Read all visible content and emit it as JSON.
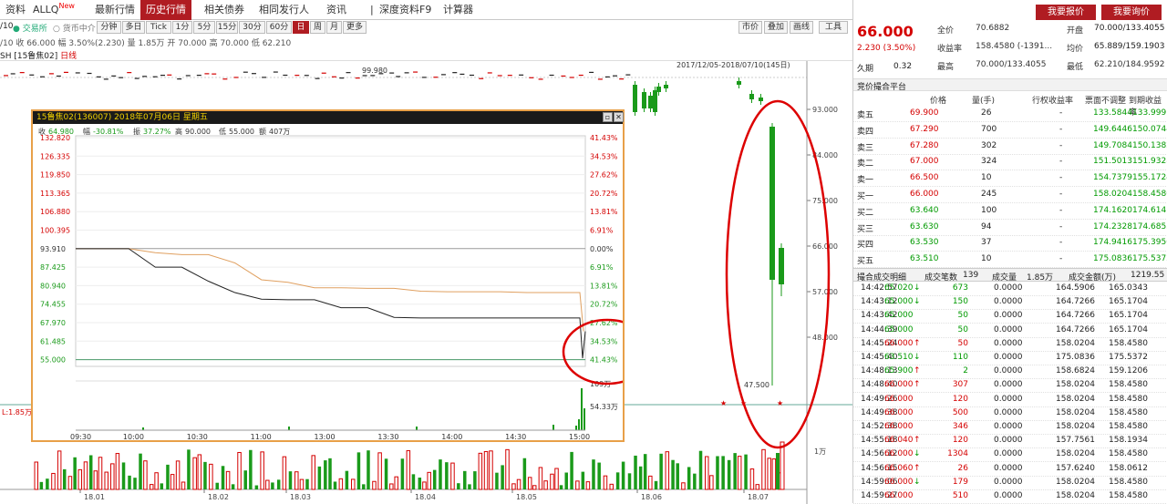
{
  "nav": {
    "tabs": [
      {
        "label": "资料",
        "active": false
      },
      {
        "label": "ALLQ",
        "sup": "New",
        "active": false
      },
      {
        "label": "最新行情",
        "active": false
      },
      {
        "label": "历史行情",
        "active": true
      },
      {
        "label": "相关债券",
        "active": false
      },
      {
        "label": "相同发行人",
        "active": false
      },
      {
        "label": "资讯",
        "active": false
      },
      {
        "label": "|",
        "active": false
      },
      {
        "label": "深度资料F9",
        "active": false
      },
      {
        "label": "计算器",
        "active": false
      }
    ]
  },
  "toolbar": {
    "date_prefix": "/10",
    "market_options": [
      "交易所",
      "货币中介"
    ],
    "periods": [
      {
        "label": "分钟",
        "active": false
      },
      {
        "label": "多日",
        "active": false
      },
      {
        "label": "Tick",
        "active": false
      },
      {
        "label": "1分",
        "active": false
      },
      {
        "label": "5分",
        "active": false
      },
      {
        "label": "15分",
        "active": false
      },
      {
        "label": "30分",
        "active": false
      },
      {
        "label": "60分",
        "active": false
      },
      {
        "label": "日",
        "active": true
      },
      {
        "label": "周",
        "active": false
      },
      {
        "label": "月",
        "active": false
      },
      {
        "label": "更多",
        "active": false
      }
    ],
    "right_buttons": [
      "市价",
      "叠加",
      "画线",
      "工具"
    ]
  },
  "quote_line": "/10 收 66.000 幅 3.50%(2.230) 量 1.85万 开 70.000 高 70.000 低 62.210",
  "security_line": {
    "code": "SH [15鲁焦02]",
    "tag": "日线"
  },
  "chart_header": {
    "range": "2017/12/05-2018/07/10(145日)",
    "annot_high": "99.980",
    "annot_low": "47.500",
    "vol_left": "L:1.85万",
    "vol_axis": "1万"
  },
  "main_chart": {
    "x_labels": [
      "18.01",
      "18.02",
      "18.03",
      "18.04",
      "18.05",
      "18.06",
      "18.07"
    ],
    "y_labels": [
      "93.000",
      "84.000",
      "75.000",
      "66.000",
      "57.000",
      "48.000"
    ]
  },
  "chart_data": [
    {
      "type": "line",
      "title": "15鲁焦02(136007) 2018年07月06日 星期五",
      "summary": {
        "收": "64.980",
        "幅": "-30.81%",
        "振": "37.27%",
        "高": "90.000",
        "低": "55.000",
        "额": "407万"
      },
      "y_left": [
        "132.820",
        "126.335",
        "119.850",
        "113.365",
        "106.880",
        "100.395",
        "93.910",
        "87.425",
        "80.940",
        "74.455",
        "67.970",
        "61.485",
        "55.000"
      ],
      "y_right": [
        "41.43%",
        "34.53%",
        "27.62%",
        "20.72%",
        "13.81%",
        "6.91%",
        "0.00%",
        "6.91%",
        "13.81%",
        "20.72%",
        "27.62%",
        "34.53%",
        "41.43%"
      ],
      "vol_labels": [
        "109万",
        "54.33万"
      ],
      "x": [
        "09:30",
        "10:00",
        "10:30",
        "11:00",
        "13:00",
        "13:30",
        "14:00",
        "14:30",
        "15:00"
      ],
      "series": [
        {
          "values": [
            93.9,
            93.9,
            93.9,
            92.5,
            91.8,
            91.8,
            88.9,
            83.0,
            82.1,
            80.2,
            80.2,
            80.0,
            80.0,
            79.0,
            78.8,
            78.8,
            78.8,
            78.5,
            78.5,
            78.5,
            64.9
          ]
        },
        {
          "values": [
            93.9,
            93.9,
            93.9,
            87.4,
            87.4,
            82.5,
            78.5,
            76.2,
            76.0,
            76.0,
            73.2,
            73.2,
            69.8,
            69.6,
            69.6,
            69.6,
            69.6,
            69.6,
            69.6,
            69.6,
            55.5,
            64.9
          ]
        }
      ]
    }
  ],
  "right": {
    "price": "66.000",
    "change": "2.230 (3.50%)",
    "buttons": [
      "我要报价",
      "我要询价"
    ],
    "stats": [
      [
        "全价",
        "70.6882",
        "开盘",
        "70.000/133.4055"
      ],
      [
        "收益率",
        "158.4580 (-1391...",
        "均价",
        "65.889/159.1903"
      ],
      [
        "最高",
        "70.000/133.4055",
        "最低",
        "62.210/184.9592"
      ]
    ],
    "period_label": "久期",
    "period_val": "0.32",
    "bid_title": "竞价撮合平台",
    "bid_headers": [
      "价格",
      "量(手)",
      "行权收益率",
      "票面不调整",
      "到期收益率"
    ],
    "asks": [
      [
        "卖五",
        "69.900",
        "26",
        "-",
        "133.5844",
        "133.9991"
      ],
      [
        "卖四",
        "67.290",
        "700",
        "-",
        "149.6446",
        "150.0744"
      ],
      [
        "卖三",
        "67.280",
        "302",
        "-",
        "149.7084",
        "150.1382"
      ],
      [
        "卖二",
        "67.000",
        "324",
        "-",
        "151.5013",
        "151.9328"
      ],
      [
        "卖一",
        "66.500",
        "10",
        "-",
        "154.7379",
        "155.1724"
      ]
    ],
    "bids": [
      [
        "买一",
        "66.000",
        "245",
        "-",
        "158.0204",
        "158.4580"
      ],
      [
        "买二",
        "63.640",
        "100",
        "-",
        "174.1620",
        "174.6147"
      ],
      [
        "买三",
        "63.630",
        "94",
        "-",
        "174.2328",
        "174.6855"
      ],
      [
        "买四",
        "63.530",
        "37",
        "-",
        "174.9416",
        "175.3950"
      ],
      [
        "买五",
        "63.510",
        "10",
        "-",
        "175.0836",
        "175.5372"
      ]
    ],
    "trade_header": {
      "title": "撮合成交明细",
      "count_label": "成交笔数",
      "count": "139",
      "vol_label": "成交量",
      "vol": "1.85万",
      "amt_label": "成交金额(万)",
      "amt": "1219.55"
    },
    "trades": [
      [
        "14:42:57",
        "65.020",
        "down",
        "673",
        "0.0000",
        "164.5906",
        "165.0343"
      ],
      [
        "14:43:12",
        "65.000",
        "down",
        "150",
        "0.0000",
        "164.7266",
        "165.1704"
      ],
      [
        "14:43:42",
        "65.000",
        "",
        "50",
        "0.0000",
        "164.7266",
        "165.1704"
      ],
      [
        "14:44:39",
        "65.000",
        "",
        "50",
        "0.0000",
        "164.7266",
        "165.1704"
      ],
      [
        "14:45:24",
        "66.000",
        "up",
        "50",
        "0.0000",
        "158.0204",
        "158.4580"
      ],
      [
        "14:45:40",
        "63.510",
        "down",
        "110",
        "0.0000",
        "175.0836",
        "175.5372"
      ],
      [
        "14:48:13",
        "65.900",
        "up",
        "2",
        "0.0000",
        "158.6824",
        "159.1206"
      ],
      [
        "14:48:40",
        "66.000",
        "up",
        "307",
        "0.0000",
        "158.0204",
        "158.4580"
      ],
      [
        "14:49:26",
        "66.000",
        "",
        "120",
        "0.0000",
        "158.0204",
        "158.4580"
      ],
      [
        "14:49:38",
        "66.000",
        "",
        "500",
        "0.0000",
        "158.0204",
        "158.4580"
      ],
      [
        "14:52:38",
        "66.000",
        "",
        "346",
        "0.0000",
        "158.0204",
        "158.4580"
      ],
      [
        "14:55:18",
        "66.040",
        "up",
        "120",
        "0.0000",
        "157.7561",
        "158.1934"
      ],
      [
        "14:56:12",
        "66.000",
        "down",
        "1304",
        "0.0000",
        "158.0204",
        "158.4580"
      ],
      [
        "14:56:15",
        "66.060",
        "up",
        "26",
        "0.0000",
        "157.6240",
        "158.0612"
      ],
      [
        "14:59:06",
        "66.000",
        "down",
        "179",
        "0.0000",
        "158.0204",
        "158.4580"
      ],
      [
        "14:59:27",
        "66.000",
        "",
        "510",
        "0.0000",
        "158.0204",
        "158.4580"
      ]
    ]
  }
}
